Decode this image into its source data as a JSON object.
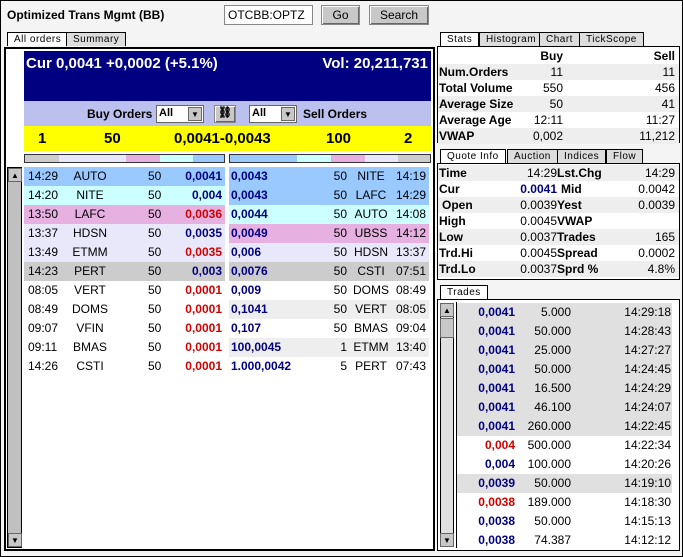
{
  "header": {
    "title": "Optimized Trans Mgmt (BB)",
    "symbol": "OTCBB:OPTZ",
    "go": "Go",
    "search": "Search"
  },
  "left_tabs": [
    "All orders",
    "Summary"
  ],
  "quote_bar": {
    "cur": "Cur 0,0041 +0,0002 (+5.1%)",
    "vol": "Vol: 20,211,731"
  },
  "filter": {
    "buy_label": "Buy Orders",
    "buy_value": "All",
    "sell_value": "All",
    "sell_label": "Sell Orders",
    "link_icon": "link-icon"
  },
  "level1": {
    "buy_count": "1",
    "buy_size": "50",
    "bid_ask": "0,0041-0,0043",
    "sell_size": "100",
    "sell_count": "2"
  },
  "colors": {
    "level1": "#99c9ff",
    "level2": "#ccffff",
    "level3": "#e6b0e0",
    "level4": "#e8e8fa",
    "level5": "#cccccc",
    "buy_price_low": "#d00000",
    "price": "#000080"
  },
  "buy_orders": [
    {
      "time": "14:29",
      "mm": "AUTO",
      "size": "50",
      "price": "0,0041",
      "red": false,
      "bg": "#99c9ff"
    },
    {
      "time": "14:20",
      "mm": "NITE",
      "size": "50",
      "price": "0,004",
      "red": false,
      "bg": "#ccffff"
    },
    {
      "time": "13:50",
      "mm": "LAFC",
      "size": "50",
      "price": "0,0036",
      "red": true,
      "bg": "#e6b0e0"
    },
    {
      "time": "13:37",
      "mm": "HDSN",
      "size": "50",
      "price": "0,0035",
      "red": false,
      "bg": "#e8e8fa"
    },
    {
      "time": "13:49",
      "mm": "ETMM",
      "size": "50",
      "price": "0,0035",
      "red": true,
      "bg": "#e8e8fa"
    },
    {
      "time": "14:23",
      "mm": "PERT",
      "size": "50",
      "price": "0,003",
      "red": false,
      "bg": "#cccccc"
    },
    {
      "time": "08:05",
      "mm": "VERT",
      "size": "50",
      "price": "0,0001",
      "red": true,
      "bg": "#ffffff"
    },
    {
      "time": "08:49",
      "mm": "DOMS",
      "size": "50",
      "price": "0,0001",
      "red": true,
      "bg": "#ffffff"
    },
    {
      "time": "09:07",
      "mm": "VFIN",
      "size": "50",
      "price": "0,0001",
      "red": true,
      "bg": "#ffffff"
    },
    {
      "time": "09:11",
      "mm": "BMAS",
      "size": "50",
      "price": "0,0001",
      "red": true,
      "bg": "#ffffff"
    },
    {
      "time": "14:26",
      "mm": "CSTI",
      "size": "50",
      "price": "0,0001",
      "red": true,
      "bg": "#ffffff"
    }
  ],
  "sell_orders": [
    {
      "price": "0,0043",
      "size": "50",
      "mm": "NITE",
      "time": "14:19",
      "bg": "#99c9ff"
    },
    {
      "price": "0,0043",
      "size": "50",
      "mm": "LAFC",
      "time": "14:29",
      "bg": "#99c9ff"
    },
    {
      "price": "0,0044",
      "size": "50",
      "mm": "AUTO",
      "time": "14:08",
      "bg": "#ccffff"
    },
    {
      "price": "0,0049",
      "size": "50",
      "mm": "UBSS",
      "time": "14:12",
      "bg": "#e6b0e0"
    },
    {
      "price": "0,006",
      "size": "50",
      "mm": "HDSN",
      "time": "13:37",
      "bg": "#e8e8fa"
    },
    {
      "price": "0,0076",
      "size": "50",
      "mm": "CSTI",
      "time": "07:51",
      "bg": "#cccccc"
    },
    {
      "price": "0,009",
      "size": "50",
      "mm": "DOMS",
      "time": "08:49",
      "bg": "#ffffff"
    },
    {
      "price": "0,1041",
      "size": "50",
      "mm": "VERT",
      "time": "08:05",
      "bg": "#eeeeee"
    },
    {
      "price": "0,107",
      "size": "50",
      "mm": "BMAS",
      "time": "09:04",
      "bg": "#ffffff"
    },
    {
      "price": "100,0045",
      "size": "1",
      "mm": "ETMM",
      "time": "13:40",
      "bg": "#eeeeee"
    },
    {
      "price": "1.000,0042",
      "size": "5",
      "mm": "PERT",
      "time": "07:43",
      "bg": "#ffffff"
    }
  ],
  "stats_tabs": [
    "Stats",
    "Histogram",
    "Chart",
    "TickScope"
  ],
  "stats": {
    "head": [
      "",
      "Buy",
      "Sell"
    ],
    "rows": [
      [
        "Num.Orders",
        "11",
        "11"
      ],
      [
        "Total Volume",
        "550",
        "456"
      ],
      [
        "Average Size",
        "50",
        "41"
      ],
      [
        "Average Age",
        "12:11",
        "11:27"
      ],
      [
        "VWAP",
        "0,002",
        "11,212"
      ]
    ]
  },
  "quote_tabs": [
    "Quote Info",
    "Auction",
    "Indices",
    "Flow"
  ],
  "quote": [
    [
      "Time",
      "14:29",
      "Lst.Chg",
      "14:29"
    ],
    [
      "Cur",
      "0.0041",
      "Mid",
      "0.0042"
    ],
    [
      "Open",
      "0.0039",
      "Yest",
      "0.0039"
    ],
    [
      "High",
      "0.0045",
      "VWAP",
      ""
    ],
    [
      "Low",
      "0.0037",
      "Trades",
      "165"
    ],
    [
      "Trd.Hi",
      "0.0045",
      "Spread",
      "0.0002"
    ],
    [
      "Trd.Lo",
      "0.0037",
      "Sprd %",
      "4.8%"
    ]
  ],
  "trades_tab": "Trades",
  "trades": [
    {
      "price": "0,0041",
      "size": "5.000",
      "time": "14:29:18",
      "red": false,
      "bg": "#e0e0e0"
    },
    {
      "price": "0,0041",
      "size": "50.000",
      "time": "14:28:43",
      "red": false,
      "bg": "#e0e0e0"
    },
    {
      "price": "0,0041",
      "size": "25.000",
      "time": "14:27:27",
      "red": false,
      "bg": "#e0e0e0"
    },
    {
      "price": "0,0041",
      "size": "50.000",
      "time": "14:24:45",
      "red": false,
      "bg": "#e0e0e0"
    },
    {
      "price": "0,0041",
      "size": "16.500",
      "time": "14:24:29",
      "red": false,
      "bg": "#e0e0e0"
    },
    {
      "price": "0,0041",
      "size": "46.100",
      "time": "14:24:07",
      "red": false,
      "bg": "#e0e0e0"
    },
    {
      "price": "0,0041",
      "size": "260.000",
      "time": "14:22:45",
      "red": false,
      "bg": "#e0e0e0"
    },
    {
      "price": "0,004",
      "size": "500.000",
      "time": "14:22:34",
      "red": true,
      "bg": "#ffffff"
    },
    {
      "price": "0,004",
      "size": "100.000",
      "time": "14:20:26",
      "red": false,
      "bg": "#ffffff"
    },
    {
      "price": "0,0039",
      "size": "50.000",
      "time": "14:19:10",
      "red": false,
      "bg": "#e0e0e0"
    },
    {
      "price": "0,0038",
      "size": "189.000",
      "time": "14:18:30",
      "red": true,
      "bg": "#ffffff"
    },
    {
      "price": "0,0038",
      "size": "50.000",
      "time": "14:15:13",
      "red": false,
      "bg": "#ffffff"
    },
    {
      "price": "0,0038",
      "size": "74.387",
      "time": "14:12:12",
      "red": false,
      "bg": "#ffffff"
    }
  ]
}
